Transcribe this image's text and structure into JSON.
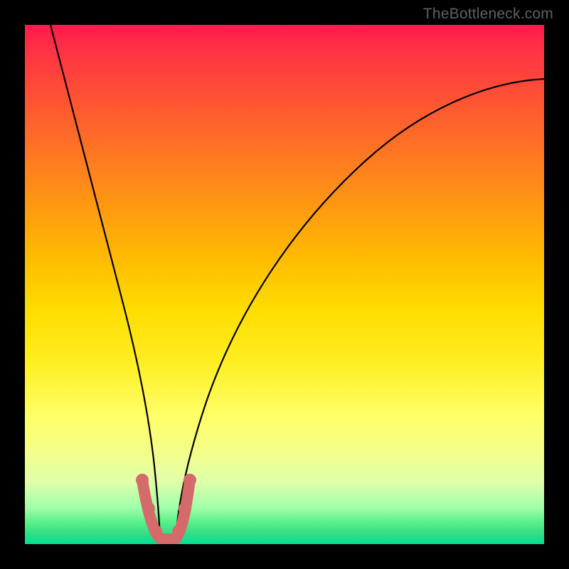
{
  "watermark": "TheBottleneck.com",
  "chart_data": {
    "type": "line",
    "title": "",
    "xlabel": "",
    "ylabel": "",
    "xlim": [
      0,
      100
    ],
    "ylim": [
      0,
      100
    ],
    "grid": false,
    "legend": false,
    "series": [
      {
        "name": "left-branch",
        "x": [
          5,
          8,
          11,
          14,
          17,
          19,
          21,
          22.5,
          24,
          25,
          26
        ],
        "y": [
          100,
          88,
          75,
          62,
          48,
          35,
          22,
          13,
          6,
          2.5,
          0.5
        ],
        "stroke": "#000000",
        "stroke_width": 2
      },
      {
        "name": "right-branch",
        "x": [
          29,
          30,
          32,
          35,
          39,
          44,
          50,
          57,
          65,
          74,
          84,
          95,
          100
        ],
        "y": [
          0.5,
          3,
          10,
          22,
          35,
          47,
          57,
          66,
          73,
          79,
          84,
          88,
          89.5
        ],
        "stroke": "#000000",
        "stroke_width": 2
      },
      {
        "name": "bottom-u-marker",
        "x": [
          22.5,
          23.5,
          24.5,
          25.5,
          27,
          28.5,
          29.5,
          30.5,
          31.5
        ],
        "y": [
          12,
          8,
          4,
          2,
          1.2,
          2,
          4,
          8,
          12
        ],
        "stroke": "#d46a6a",
        "stroke_width": 12,
        "linecap": "round"
      }
    ]
  }
}
